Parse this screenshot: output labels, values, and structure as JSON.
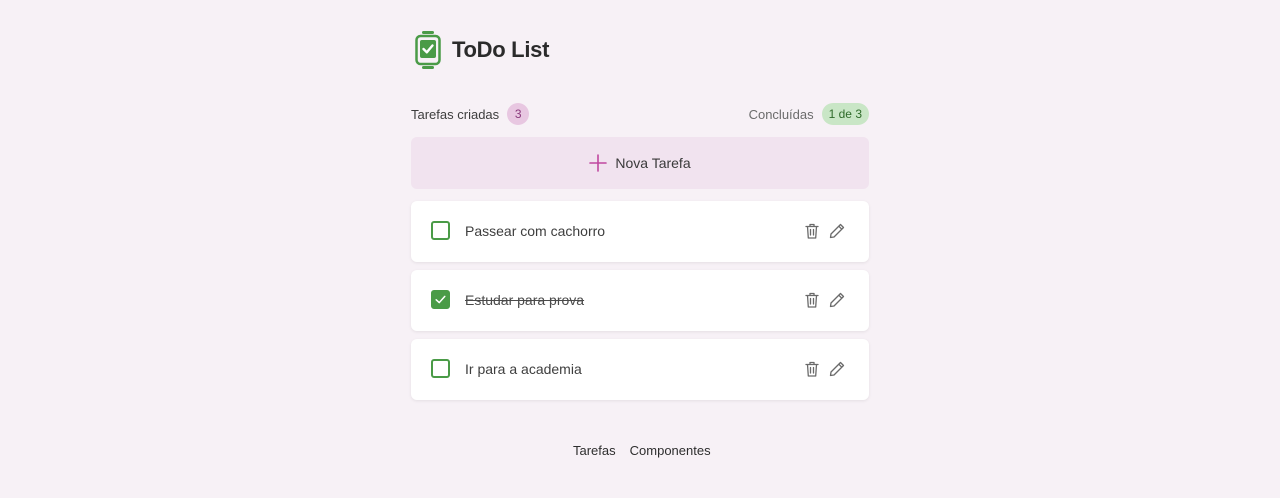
{
  "app": {
    "title": "ToDo List",
    "logo_icon": "clipboard-check-icon"
  },
  "summary": {
    "created_label": "Tarefas criadas",
    "created_count": "3",
    "completed_label": "Concluídas",
    "completed_count": "1 de 3"
  },
  "new_task": {
    "label": "Nova Tarefa",
    "icon": "plus-icon"
  },
  "tasks": [
    {
      "label": "Passear com cachorro",
      "done": false
    },
    {
      "label": "Estudar para prova",
      "done": true
    },
    {
      "label": "Ir para a academia",
      "done": false
    }
  ],
  "task_actions": {
    "delete_icon": "trash-icon",
    "edit_icon": "pencil-icon"
  },
  "footer": {
    "links": [
      "Tarefas",
      "Componentes"
    ]
  },
  "colors": {
    "background": "#f7f1f6",
    "accent_green": "#4a9b47",
    "accent_pink": "#c0479f",
    "new_task_bg": "#f1e3ef",
    "badge_pink_bg": "#e8c7e1",
    "badge_green_bg": "#c9e6c6"
  }
}
